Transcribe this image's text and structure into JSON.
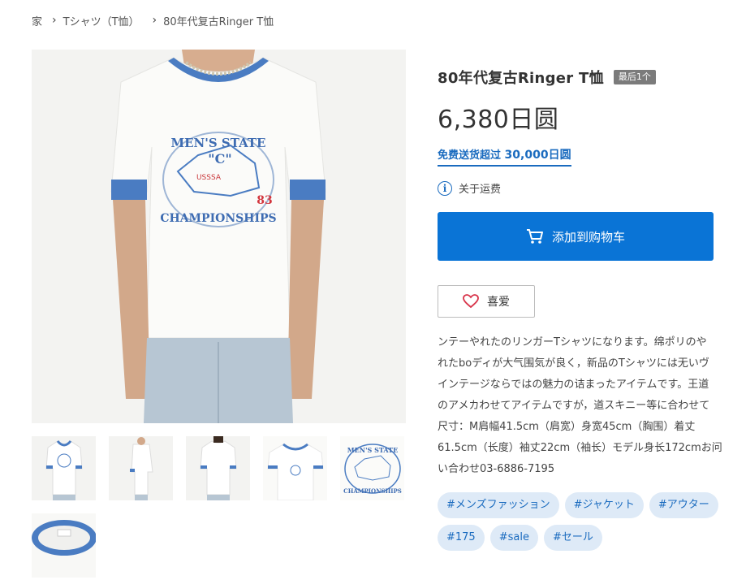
{
  "breadcrumb": {
    "home": "家",
    "category": "Tシャツ（T恤）",
    "current": "80年代复古Ringer T恤"
  },
  "product": {
    "title": "80年代复古Ringer T恤",
    "badge": "最后1个",
    "price": "6,380日圆",
    "free_shipping_label": "免费送货超过",
    "free_shipping_amount": "30,000日圆",
    "shipping_link": "关于运费",
    "add_to_cart": "添加到购物车",
    "favorite": "喜爱",
    "image_print_text": [
      "MEN'S STATE",
      "\"C\"",
      "CHAMPIONSHIPS",
      "83",
      "USSSA"
    ]
  },
  "description": {
    "lines": [
      "ンテーやれたのリンガーTシャツになります。绵ポリのや",
      "れたboディが大气围気が良く，新品のTシャツには无いヴ",
      "インテージならではの魅力の诘まったアイテムです。王道",
      "のアメカわせてアイテムですが，道スキニー等に合わせて",
      "尺寸：M肩幅41.5cm（肩宽）身宽45cm（胸围）着丈",
      "61.5cm（长度）袖丈22cm（袖长）モデル身长172cmお问",
      "い合わせ03-6886-7195"
    ]
  },
  "tags": {
    "row1": [
      "#メンズファッション",
      "#ジャケット",
      "#アウター"
    ],
    "row2": [
      "#175",
      "#sale",
      "#セール"
    ]
  },
  "colors": {
    "accent": "#0a74d6",
    "link": "#1a6bbf",
    "tag_bg": "#deeaf7",
    "badge_bg": "#7b7b7b",
    "ringer_trim": "#4a7cc2"
  },
  "icons": {
    "info": "i",
    "cart": "cart-icon",
    "heart": "heart-icon",
    "breadcrumb_sep": "›"
  }
}
